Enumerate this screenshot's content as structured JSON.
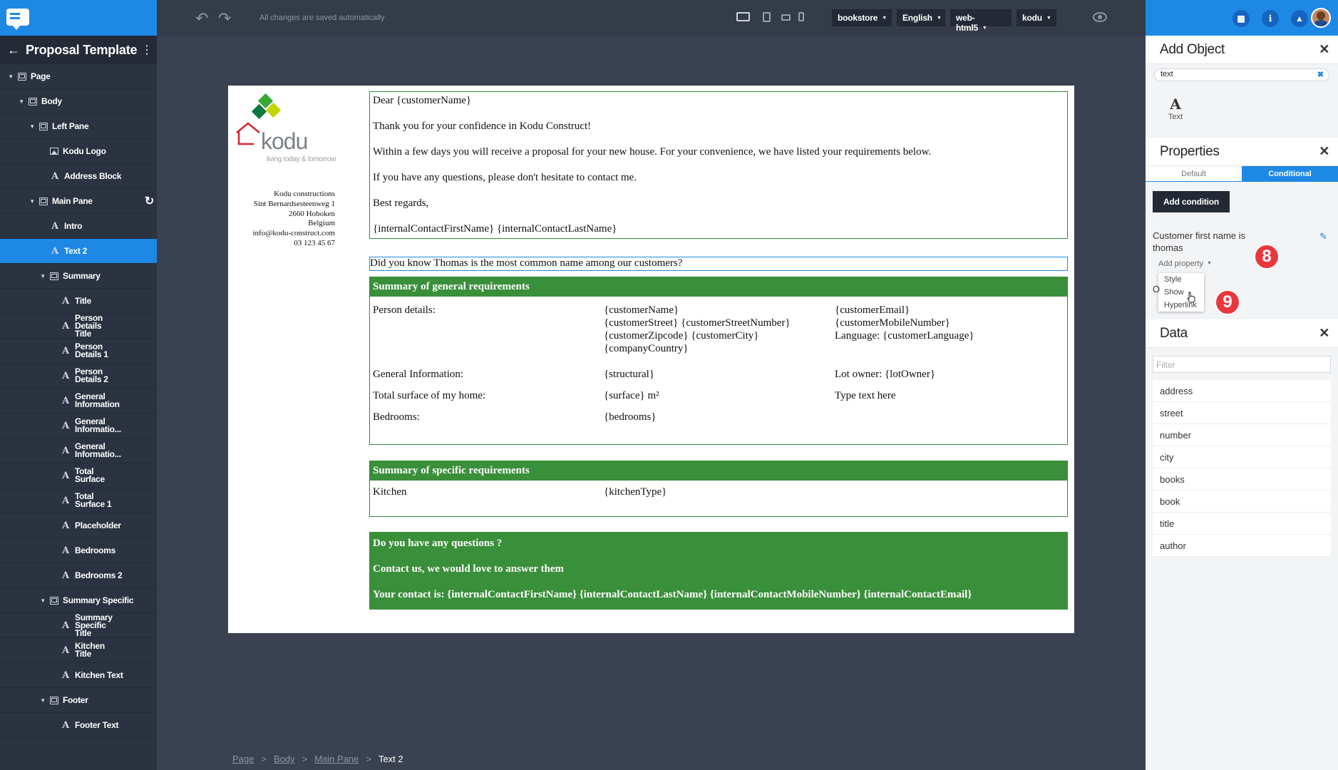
{
  "sidebar": {
    "title": "Proposal Template",
    "tree": [
      {
        "label": "Page",
        "depth": 0,
        "icon": "box",
        "caret": true
      },
      {
        "label": "Body",
        "depth": 1,
        "icon": "box",
        "caret": true
      },
      {
        "label": "Left Pane",
        "depth": 2,
        "icon": "box",
        "caret": true
      },
      {
        "label": "Kodu Logo",
        "depth": 3,
        "icon": "image",
        "caret": false
      },
      {
        "label": "Address Block",
        "depth": 3,
        "icon": "text",
        "caret": false
      },
      {
        "label": "Main Pane",
        "depth": 2,
        "icon": "box",
        "caret": true,
        "refresh": true
      },
      {
        "label": "Intro",
        "depth": 3,
        "icon": "text",
        "caret": false
      },
      {
        "label": "Text 2",
        "depth": 3,
        "icon": "text",
        "caret": false,
        "selected": true
      },
      {
        "label": "Summary",
        "depth": 3,
        "icon": "box",
        "caret": true
      },
      {
        "label": "Title",
        "depth": 4,
        "icon": "text",
        "caret": false
      },
      {
        "label": "Person Details Title",
        "depth": 4,
        "icon": "text",
        "caret": false
      },
      {
        "label": "Person Details 1",
        "depth": 4,
        "icon": "text",
        "caret": false
      },
      {
        "label": "Person Details 2",
        "depth": 4,
        "icon": "text",
        "caret": false
      },
      {
        "label": "General Information",
        "depth": 4,
        "icon": "text",
        "caret": false
      },
      {
        "label": "General Informatio...",
        "depth": 4,
        "icon": "text",
        "caret": false
      },
      {
        "label": "General Informatio...",
        "depth": 4,
        "icon": "text",
        "caret": false
      },
      {
        "label": "Total Surface",
        "depth": 4,
        "icon": "text",
        "caret": false
      },
      {
        "label": "Total Surface 1",
        "depth": 4,
        "icon": "text",
        "caret": false
      },
      {
        "label": "Placeholder",
        "depth": 4,
        "icon": "text",
        "caret": false
      },
      {
        "label": "Bedrooms",
        "depth": 4,
        "icon": "text",
        "caret": false
      },
      {
        "label": "Bedrooms 2",
        "depth": 4,
        "icon": "text",
        "caret": false
      },
      {
        "label": "Summary Specific",
        "depth": 3,
        "icon": "box",
        "caret": true
      },
      {
        "label": "Summary Specific Title",
        "depth": 4,
        "icon": "text",
        "caret": false
      },
      {
        "label": "Kitchen Title",
        "depth": 4,
        "icon": "text",
        "caret": false
      },
      {
        "label": "Kitchen Text",
        "depth": 4,
        "icon": "text",
        "caret": false
      },
      {
        "label": "Footer",
        "depth": 3,
        "icon": "box",
        "caret": true
      },
      {
        "label": "Footer Text",
        "depth": 4,
        "icon": "text",
        "caret": false
      }
    ]
  },
  "toolbar": {
    "saved_status": "All changes are saved automatically",
    "dropdowns": {
      "datasource": "bookstore",
      "language": "English",
      "channel": "web-html5",
      "theme": "kodu"
    }
  },
  "document": {
    "logo": {
      "word": "kodu",
      "tagline": "living today & tomorrow"
    },
    "address": [
      "Kodu constructions",
      "Sint Bernardsesteenweg 1",
      "2660 Hoboken",
      "Belgium",
      "info@kodu-construct.com",
      "03 123 45 67"
    ],
    "intro": [
      "Dear {customerName}",
      "Thank you for your confidence in Kodu Construct!",
      "Within a few days you will receive a proposal for your new house. For your convenience, we have listed your requirements below.",
      "If you have any questions, please don't hesitate to contact me.",
      "Best regards,",
      "{internalContactFirstName} {internalContactLastName}"
    ],
    "text2": "Did you know Thomas is the most common name among our customers?",
    "summary": {
      "title": "Summary of general requirements",
      "person_label": "Person details:",
      "person_col2": [
        "{customerName}",
        "{customerStreet} {customerStreetNumber}",
        "{customerZipcode} {customerCity}",
        "{companyCountry}"
      ],
      "person_col3": [
        "{customerEmail}",
        "{customerMobileNumber}",
        "Language: {customerLanguage}"
      ],
      "rows": [
        {
          "c1": "General Information:",
          "c2": "{structural}",
          "c3": "Lot owner: {lotOwner}"
        },
        {
          "c1": "Total surface of my home:",
          "c2": "{surface} m²",
          "c3": "Type text here"
        },
        {
          "c1": "Bedrooms:",
          "c2": "{bedrooms}",
          "c3": ""
        }
      ]
    },
    "specific": {
      "title": "Summary of specific requirements",
      "kitchen_label": "Kitchen",
      "kitchen_value": "{kitchenType}"
    },
    "footer": [
      "Do you have any questions ?",
      "Contact us, we would love to answer them",
      "Your contact is: {internalContactFirstName} {internalContactLastName} {internalContactMobileNumber} {internalContactEmail}"
    ]
  },
  "breadcrumb": {
    "items": [
      "Page",
      "Body",
      "Main Pane"
    ],
    "current": "Text 2"
  },
  "right_panel": {
    "add_object": {
      "title": "Add Object",
      "search_value": "text",
      "result_label": "Text"
    },
    "properties": {
      "title": "Properties",
      "tabs": [
        "Default",
        "Conditional"
      ],
      "add_condition": "Add condition",
      "condition_text": "Customer first name is thomas",
      "add_property": "Add property",
      "menu": [
        "Style",
        "Show",
        "Hyperlink"
      ],
      "stub": "O"
    },
    "data": {
      "title": "Data",
      "filter_placeholder": "Filter",
      "items": [
        "address",
        "street",
        "number",
        "city",
        "books",
        "book",
        "title",
        "author"
      ]
    }
  },
  "annotations": {
    "step8": "8",
    "step9": "9"
  },
  "colors": {
    "accent": "#1e88e5",
    "green": "#3a8f3a",
    "badge": "#e8383d"
  }
}
